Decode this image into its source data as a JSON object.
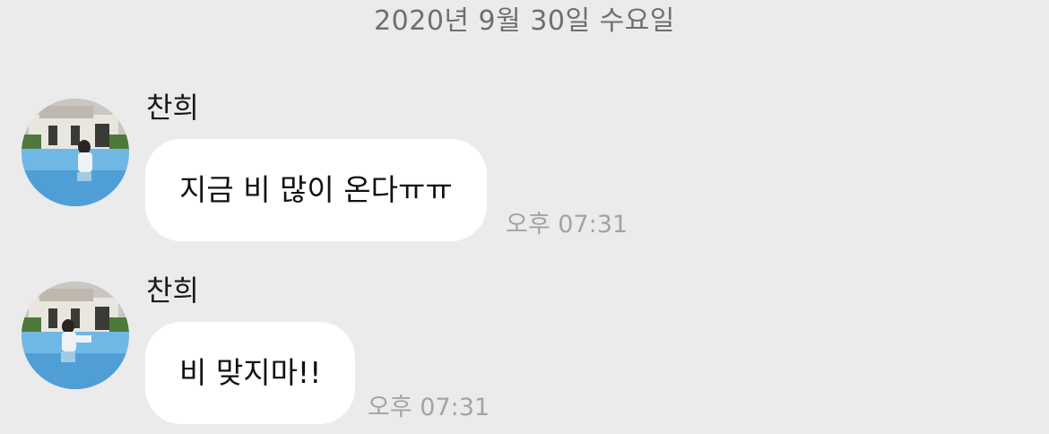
{
  "chat": {
    "date": "2020년 9월 30일 수요일",
    "messages": [
      {
        "sender": "찬희",
        "text": "지금 비 많이 온다ㅠㅠ",
        "time": "오후 07:31",
        "avatar_icon": "profile-photo-pool"
      },
      {
        "sender": "찬희",
        "text": "비 맞지마!!",
        "time": "오후 07:31",
        "avatar_icon": "profile-photo-pool"
      }
    ]
  },
  "colors": {
    "background": "#ebebeb",
    "bubble": "#ffffff",
    "date_text": "#6f6f6f",
    "time_text": "#a3a3a3"
  }
}
